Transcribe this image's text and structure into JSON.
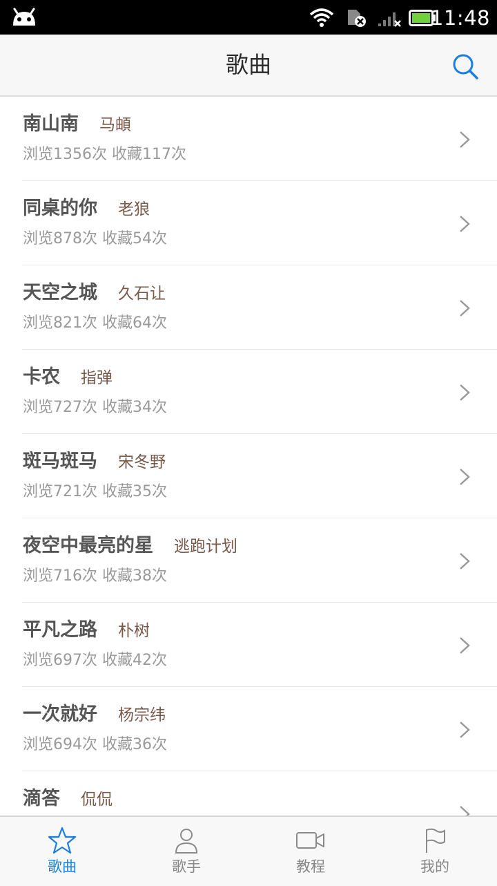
{
  "status_bar": {
    "time": "11:48"
  },
  "header": {
    "title": "歌曲"
  },
  "songs": [
    {
      "title": "南山南",
      "artist": "马頔",
      "stats": "浏览1356次 收藏117次"
    },
    {
      "title": "同桌的你",
      "artist": "老狼",
      "stats": "浏览878次 收藏54次"
    },
    {
      "title": "天空之城",
      "artist": "久石让",
      "stats": "浏览821次 收藏64次"
    },
    {
      "title": "卡农",
      "artist": "指弹",
      "stats": "浏览727次 收藏34次"
    },
    {
      "title": "斑马斑马",
      "artist": "宋冬野",
      "stats": "浏览721次 收藏35次"
    },
    {
      "title": "夜空中最亮的星",
      "artist": "逃跑计划",
      "stats": "浏览716次 收藏38次"
    },
    {
      "title": "平凡之路",
      "artist": "朴树",
      "stats": "浏览697次 收藏42次"
    },
    {
      "title": "一次就好",
      "artist": "杨宗纬",
      "stats": "浏览694次 收藏36次"
    },
    {
      "title": "滴答",
      "artist": "侃侃",
      "stats": ""
    }
  ],
  "nav": {
    "tabs": [
      {
        "label": "歌曲",
        "icon": "star-icon",
        "active": true
      },
      {
        "label": "歌手",
        "icon": "person-icon",
        "active": false
      },
      {
        "label": "教程",
        "icon": "video-camera-icon",
        "active": false
      },
      {
        "label": "我的",
        "icon": "flag-icon",
        "active": false
      }
    ]
  },
  "colors": {
    "accent": "#1a7ee0",
    "artist": "#7a5a4a",
    "meta": "#9a9a9a"
  }
}
